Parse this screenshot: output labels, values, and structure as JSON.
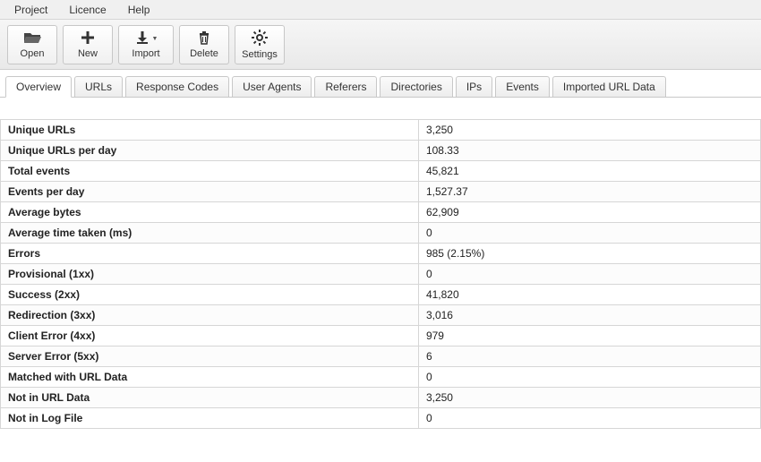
{
  "menubar": {
    "items": [
      {
        "label": "Project"
      },
      {
        "label": "Licence"
      },
      {
        "label": "Help"
      }
    ]
  },
  "toolbar": {
    "open": {
      "label": "Open"
    },
    "new": {
      "label": "New"
    },
    "import": {
      "label": "Import"
    },
    "delete": {
      "label": "Delete"
    },
    "settings": {
      "label": "Settings"
    }
  },
  "tabs": [
    {
      "label": "Overview",
      "active": true
    },
    {
      "label": "URLs"
    },
    {
      "label": "Response Codes"
    },
    {
      "label": "User Agents"
    },
    {
      "label": "Referers"
    },
    {
      "label": "Directories"
    },
    {
      "label": "IPs"
    },
    {
      "label": "Events"
    },
    {
      "label": "Imported URL Data"
    }
  ],
  "overview": [
    {
      "label": "Unique URLs",
      "value": "3,250"
    },
    {
      "label": "Unique URLs per day",
      "value": "108.33"
    },
    {
      "label": "Total events",
      "value": "45,821"
    },
    {
      "label": "Events per day",
      "value": "1,527.37"
    },
    {
      "label": "Average bytes",
      "value": "62,909"
    },
    {
      "label": "Average time taken (ms)",
      "value": "0"
    },
    {
      "label": "Errors",
      "value": "985 (2.15%)"
    },
    {
      "label": "Provisional (1xx)",
      "value": "0"
    },
    {
      "label": "Success (2xx)",
      "value": "41,820"
    },
    {
      "label": "Redirection (3xx)",
      "value": "3,016"
    },
    {
      "label": "Client Error (4xx)",
      "value": "979"
    },
    {
      "label": "Server Error (5xx)",
      "value": "6"
    },
    {
      "label": "Matched with URL Data",
      "value": "0"
    },
    {
      "label": "Not in URL Data",
      "value": "3,250"
    },
    {
      "label": "Not in Log File",
      "value": "0"
    }
  ]
}
